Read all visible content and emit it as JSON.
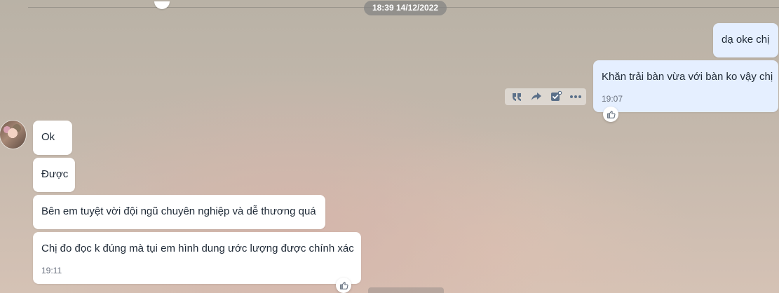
{
  "date_separator": "18:39 14/12/2022",
  "messages_sent": {
    "first": {
      "text": "dạ oke chị"
    },
    "second": {
      "text": "Khăn trải bàn vừa với bàn ko vậy chị",
      "time": "19:07"
    }
  },
  "messages_received": {
    "first": {
      "text": "Ok"
    },
    "second": {
      "text": "Được"
    },
    "third": {
      "text": "Bên em tuyệt vời đội ngũ chuyên nghiệp và dễ thương quá"
    },
    "fourth": {
      "text": "Chị đo đọc k đúng mà tụi em hình dung ước lượng được chính xác",
      "time": "19:11"
    }
  },
  "message_actions": [
    "quote-icon",
    "forward-icon",
    "select-task-icon",
    "more-icon"
  ],
  "colors": {
    "sent_bubble": "#e5efff",
    "received_bubble": "#ffffff",
    "date_chip": "#828282",
    "action_icon": "#5b7089"
  }
}
